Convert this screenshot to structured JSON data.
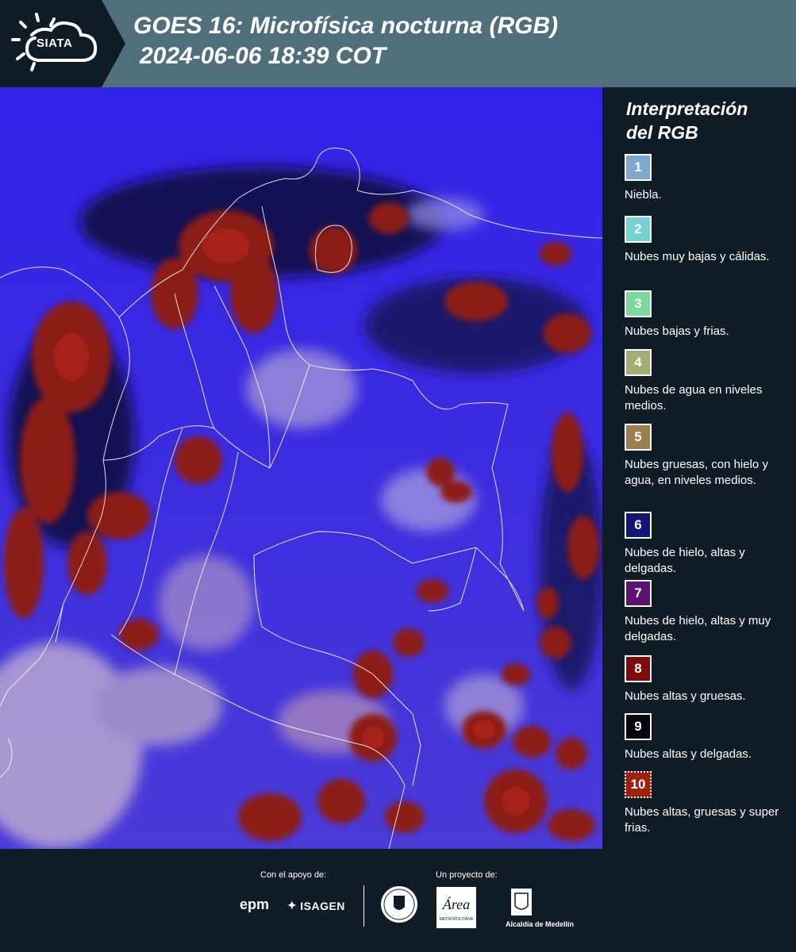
{
  "header": {
    "logo_text": "SIATA",
    "title_line1": "GOES 16: Microfísica nocturna (RGB)",
    "title_line2": "2024-06-06 18:39 COT"
  },
  "map": {
    "background_color": "#3a1fe6",
    "cloud_colors": [
      "#8b1a14",
      "#b0221a",
      "#c8b8d8",
      "#b9a8c8",
      "#0e0d3a"
    ],
    "boundary_color": "#ffffff"
  },
  "legend": {
    "title_line1": "Interpretación",
    "title_line2": "del RGB",
    "items": [
      {
        "number": "1",
        "label": "Niebla.",
        "color": "#7ea7cc"
      },
      {
        "number": "2",
        "label": "Nubes muy bajas y cálidas.",
        "color": "#72d4d4"
      },
      {
        "number": "3",
        "label": "Nubes bajas y frias.",
        "color": "#7fd79f"
      },
      {
        "number": "4",
        "label": "Nubes de agua en niveles medios.",
        "color": "#a1ad74"
      },
      {
        "number": "5",
        "label": "Nubes gruesas, con hielo y agua, en niveles medios.",
        "color": "#9c7f4f"
      },
      {
        "number": "6",
        "label": "Nubes de hielo, altas y delgadas.",
        "color": "#111575"
      },
      {
        "number": "7",
        "label": "Nubes de hielo, altas y muy delgadas.",
        "color": "#5a1374"
      },
      {
        "number": "8",
        "label": "Nubes altas y gruesas.",
        "color": "#7d0b0b"
      },
      {
        "number": "9",
        "label": "Nubes altas y delgadas.",
        "color": "#07060e"
      },
      {
        "number": "10",
        "label": "Nubes altas, gruesas y super frias.",
        "color": "#a0200e"
      }
    ]
  },
  "footer": {
    "support_label": "Con el apoyo de:",
    "project_label": "Un proyecto de:",
    "sponsor1": "epm",
    "sponsor2": "ISAGEN",
    "partner1": "METROPOLITANA",
    "partner2": "Alcaldía de Medellín"
  }
}
